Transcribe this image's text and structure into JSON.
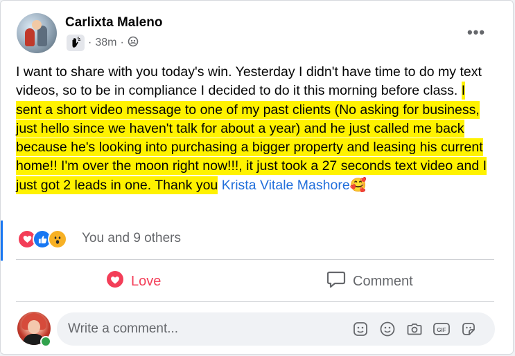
{
  "post": {
    "author": "Carlixta Maleno",
    "time": "38m",
    "separator": "·",
    "text_plain_1": "I want to share with you today's win. Yesterday I didn't have time to do my text videos, so to be in compliance I decided to do it this morning before class. ",
    "text_highlighted": "I sent a short video message to one of my past clients (No asking for business, just hello since we haven't talk for about a year) and he just called me back because he's looking into purchasing a bigger property and leasing his current home!! I'm over the moon right now!!!, it just took a 27 seconds text video and I just got 2 leads in one. Thank you",
    "mention": "Krista Vitale Mashore",
    "emoji": "🥰",
    "more_icon": "more-horizontal-icon"
  },
  "reactions": {
    "summary": "You and 9 others",
    "types": [
      "love",
      "like",
      "wow"
    ]
  },
  "actions": {
    "love_label": "Love",
    "comment_label": "Comment"
  },
  "comment_box": {
    "placeholder": "Write a comment...",
    "tools": [
      "avatar-sticker-icon",
      "emoji-icon",
      "camera-icon",
      "gif-icon",
      "sticker-icon"
    ]
  },
  "colors": {
    "highlight": "#fff200",
    "love": "#f33e58",
    "like": "#1877f2",
    "link": "#216fdb",
    "muted": "#65676b"
  }
}
